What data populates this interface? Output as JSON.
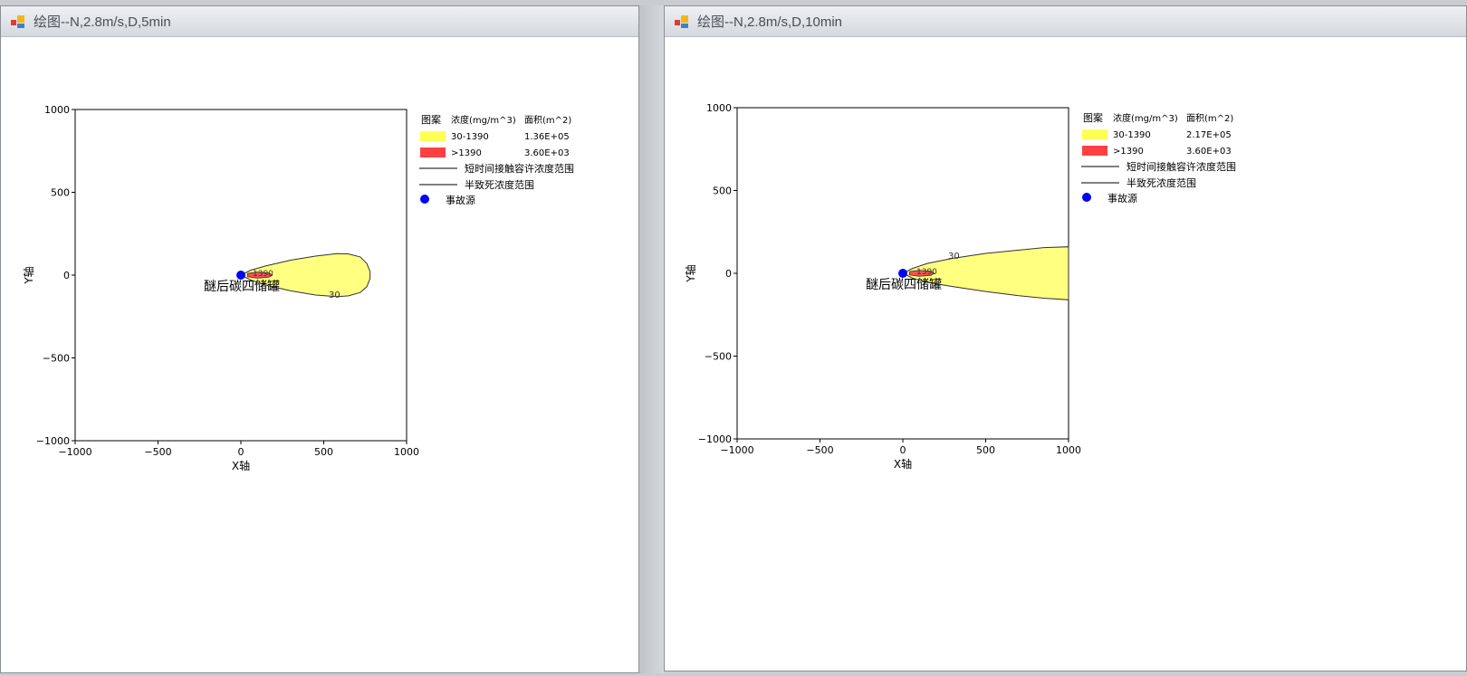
{
  "windows": [
    {
      "title": "绘图--N,2.8m/s,D,5min",
      "legend": {
        "header_pattern": "图案",
        "header_conc": "浓度(mg/m^3)",
        "header_area": "面积(m^2)",
        "rows": [
          {
            "range": "30-1390",
            "area": "1.36E+05",
            "color": "#ffff55"
          },
          {
            "range": ">1390",
            "area": "3.60E+03",
            "color": "#ff4040"
          }
        ],
        "line1": "短时间接触容许浓度范围",
        "line2": "半致死浓度范围",
        "source": "事故源"
      },
      "source_label": "醚后碳四储罐",
      "contour_labels": {
        "inner": "1390",
        "outer": "30"
      },
      "chart_data": {
        "type": "contour",
        "xlabel": "X轴",
        "ylabel": "Y轴",
        "xlim": [
          -1000,
          1000
        ],
        "ylim": [
          -1000,
          1000
        ],
        "xticks": [
          -1000,
          -500,
          0,
          500,
          1000
        ],
        "yticks": [
          -1000,
          -500,
          0,
          500,
          1000
        ],
        "xtick_labels": [
          "−1000",
          "−500",
          "0",
          "500",
          "1000"
        ],
        "ytick_labels": [
          "−1000",
          "−500",
          "0",
          "500",
          "1000"
        ],
        "source_point": [
          0,
          0
        ],
        "outer_contour": [
          [
            0,
            0
          ],
          [
            60,
            30
          ],
          [
            150,
            55
          ],
          [
            300,
            90
          ],
          [
            450,
            115
          ],
          [
            580,
            130
          ],
          [
            650,
            128
          ],
          [
            720,
            110
          ],
          [
            760,
            70
          ],
          [
            780,
            20
          ],
          [
            780,
            -20
          ],
          [
            760,
            -70
          ],
          [
            720,
            -105
          ],
          [
            650,
            -125
          ],
          [
            580,
            -130
          ],
          [
            450,
            -120
          ],
          [
            300,
            -95
          ],
          [
            150,
            -60
          ],
          [
            60,
            -30
          ],
          [
            0,
            0
          ]
        ],
        "inner_contour": [
          [
            40,
            10
          ],
          [
            100,
            18
          ],
          [
            170,
            12
          ],
          [
            190,
            0
          ],
          [
            170,
            -12
          ],
          [
            100,
            -18
          ],
          [
            40,
            -10
          ]
        ]
      }
    },
    {
      "title": "绘图--N,2.8m/s,D,10min",
      "legend": {
        "header_pattern": "图案",
        "header_conc": "浓度(mg/m^3)",
        "header_area": "面积(m^2)",
        "rows": [
          {
            "range": "30-1390",
            "area": "2.17E+05",
            "color": "#ffff55"
          },
          {
            "range": ">1390",
            "area": "3.60E+03",
            "color": "#ff4040"
          }
        ],
        "line1": "短时间接触容许浓度范围",
        "line2": "半致死浓度范围",
        "source": "事故源"
      },
      "source_label": "醚后碳四储罐",
      "contour_labels": {
        "inner": "1390",
        "outer": "30"
      },
      "chart_data": {
        "type": "contour",
        "xlabel": "X轴",
        "ylabel": "Y轴",
        "xlim": [
          -1000,
          1000
        ],
        "ylim": [
          -1000,
          1000
        ],
        "xticks": [
          -1000,
          -500,
          0,
          500,
          1000
        ],
        "yticks": [
          -1000,
          -500,
          0,
          500,
          1000
        ],
        "xtick_labels": [
          "−1000",
          "−500",
          "0",
          "500",
          "1000"
        ],
        "ytick_labels": [
          "−1000",
          "−500",
          "0",
          "500",
          "1000"
        ],
        "source_point": [
          0,
          0
        ],
        "outer_contour": [
          [
            0,
            0
          ],
          [
            60,
            30
          ],
          [
            150,
            60
          ],
          [
            300,
            90
          ],
          [
            500,
            120
          ],
          [
            700,
            140
          ],
          [
            850,
            155
          ],
          [
            1000,
            160
          ],
          [
            1000,
            -160
          ],
          [
            850,
            -150
          ],
          [
            700,
            -135
          ],
          [
            500,
            -110
          ],
          [
            300,
            -80
          ],
          [
            150,
            -55
          ],
          [
            60,
            -30
          ],
          [
            0,
            0
          ]
        ],
        "inner_contour": [
          [
            40,
            10
          ],
          [
            100,
            18
          ],
          [
            170,
            12
          ],
          [
            190,
            0
          ],
          [
            170,
            -12
          ],
          [
            100,
            -18
          ],
          [
            40,
            -10
          ]
        ]
      }
    }
  ]
}
